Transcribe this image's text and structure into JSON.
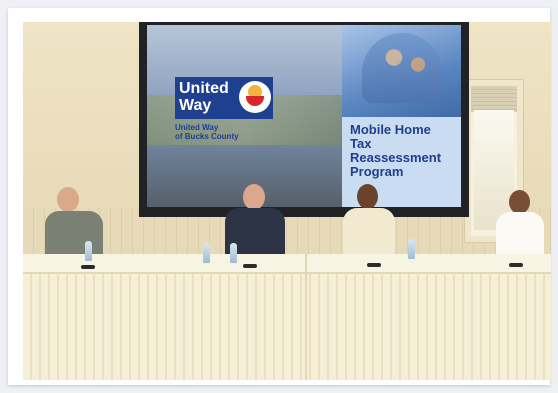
{
  "slide": {
    "org_name_line1": "United",
    "org_name_line2": "Way",
    "org_sub_line1": "United Way",
    "org_sub_line2": "of Bucks County",
    "title_line1": "Mobile Home",
    "title_line2": "Tax",
    "title_line3": "Reassessment",
    "title_line4": "Program"
  },
  "colors": {
    "brand_blue": "#1f3f8f",
    "title_panel": "#c9dcf2",
    "tablecloth": "#f4efd6"
  }
}
